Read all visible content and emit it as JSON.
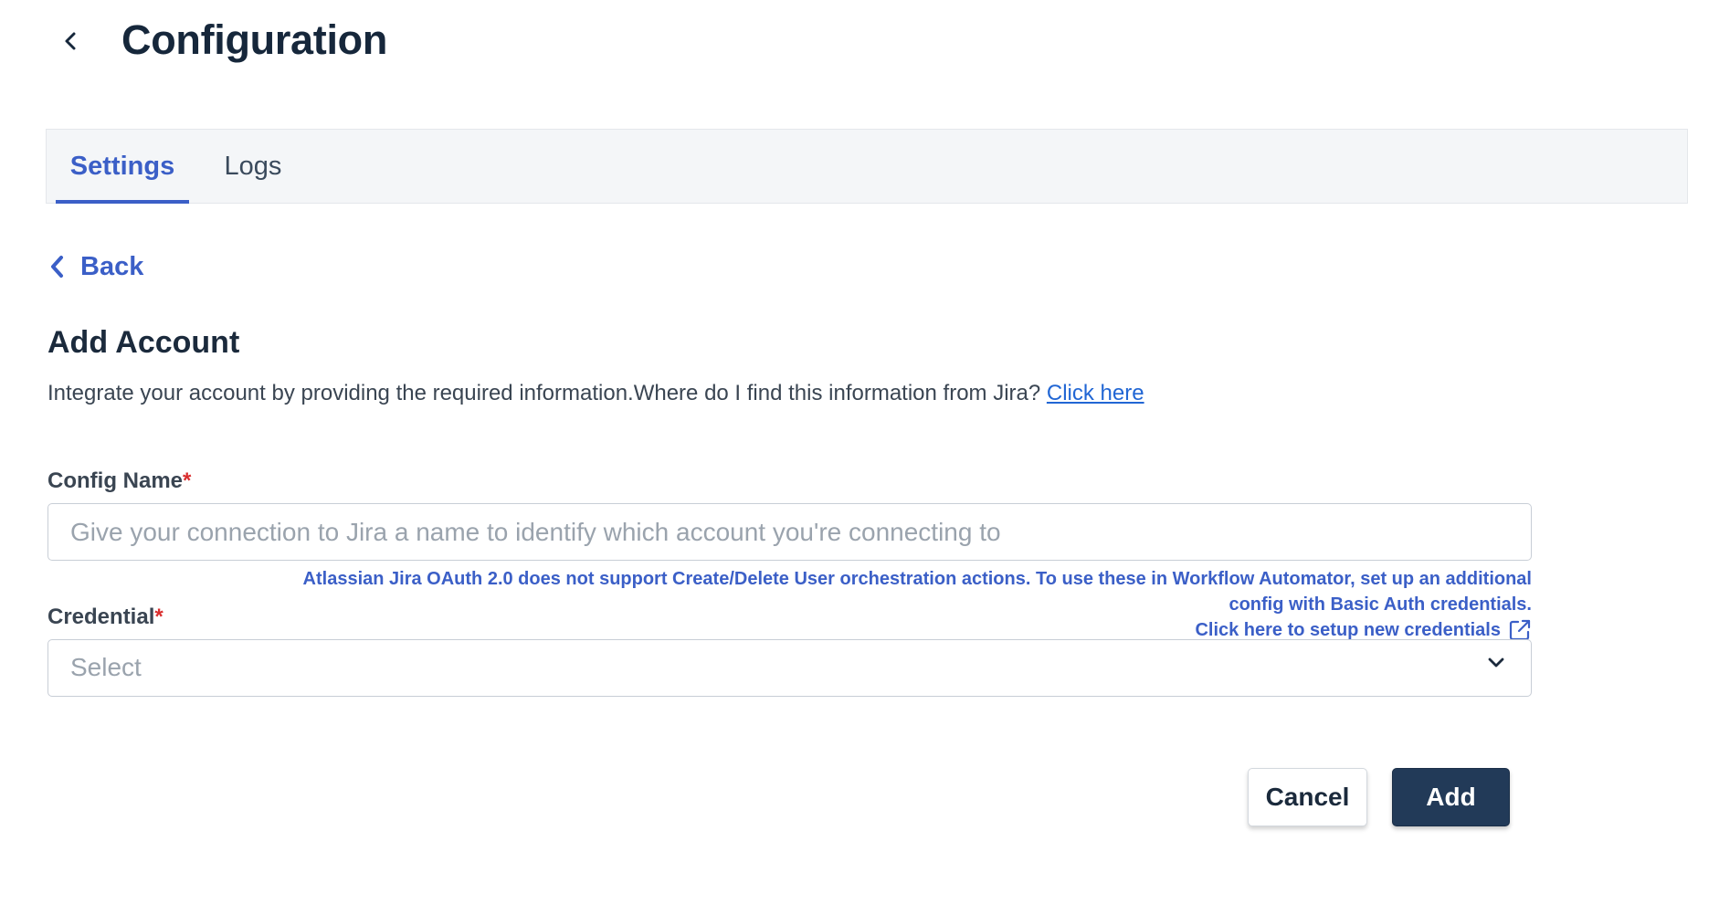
{
  "header": {
    "title": "Configuration"
  },
  "tabs": [
    {
      "label": "Settings",
      "active": true
    },
    {
      "label": "Logs",
      "active": false
    }
  ],
  "back_link": {
    "label": "Back"
  },
  "section": {
    "title": "Add Account",
    "description": "Integrate your account by providing the required information.Where do I find this information from Jira? ",
    "description_link": "Click here"
  },
  "form": {
    "config_name": {
      "label": "Config Name",
      "required_mark": "*",
      "placeholder": "Give your connection to Jira a name to identify which account you're connecting to",
      "value": ""
    },
    "oauth_note": {
      "line1": "Atlassian Jira OAuth 2.0 does not support Create/Delete User orchestration actions. To use these in Workflow Automator, set up an additional",
      "line2": "config with Basic Auth credentials.",
      "link": "Click here to setup new credentials"
    },
    "credential": {
      "label": "Credential",
      "required_mark": "*",
      "placeholder": "Select"
    }
  },
  "actions": {
    "cancel_label": "Cancel",
    "add_label": "Add"
  },
  "colors": {
    "accent": "#3b5fc7",
    "link": "#2166d4",
    "primary_button": "#223a58",
    "required": "#d92d2d",
    "title": "#16273b"
  },
  "icons": {
    "header_back": "chevron-left-icon",
    "back_link": "chevron-left-icon",
    "external_link": "external-link-icon",
    "select_dropdown": "chevron-down-icon"
  }
}
